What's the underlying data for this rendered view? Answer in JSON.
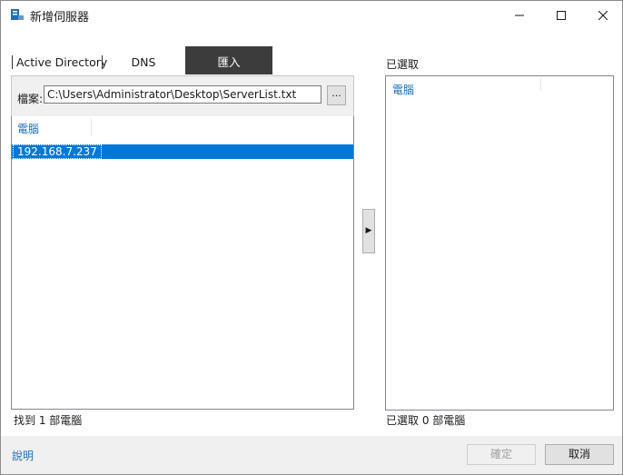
{
  "window": {
    "title": "新增伺服器"
  },
  "tabs": [
    {
      "label": "Active Directory",
      "active": false
    },
    {
      "label": "DNS",
      "active": false
    },
    {
      "label": "匯入",
      "active": true
    }
  ],
  "import": {
    "file_label": "檔案:",
    "file_path": "C:\\Users\\Administrator\\Desktop\\ServerList.txt",
    "browse_label": "..."
  },
  "available_list": {
    "column_header": "電腦",
    "items": [
      "192.168.7.237"
    ],
    "status": "找到 1 部電腦"
  },
  "add_arrow": "▶",
  "selected_list": {
    "title": "已選取",
    "column_header": "電腦",
    "status": "已選取 0 部電腦"
  },
  "footer": {
    "help_label": "說明",
    "ok_label": "確定",
    "cancel_label": "取消"
  },
  "colors": {
    "selection": "#0078d7",
    "link": "#1e6fb8",
    "active_tab": "#3c3c3c"
  }
}
